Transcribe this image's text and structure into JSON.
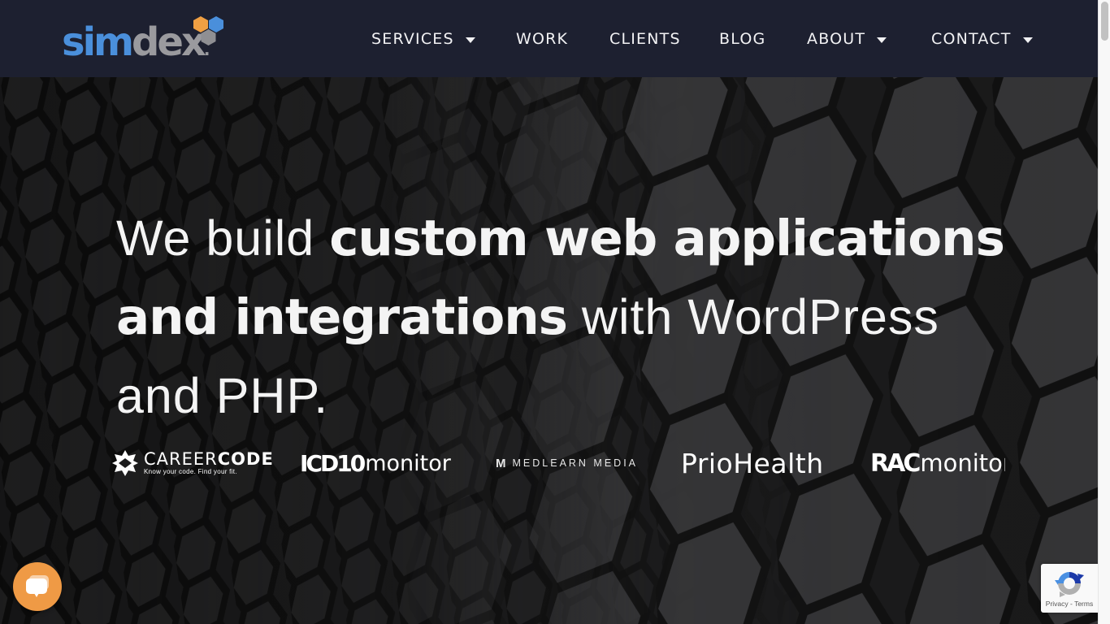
{
  "brand": {
    "name_part1": "sim",
    "name_part2": "dex",
    "name_dot": ".",
    "colors": {
      "blue": "#4a8fdb",
      "gray": "#9a9a9e",
      "orange": "#f0a043"
    }
  },
  "nav": {
    "items": [
      {
        "label": "SERVICES",
        "has_dropdown": true
      },
      {
        "label": "WORK",
        "has_dropdown": false
      },
      {
        "label": "CLIENTS",
        "has_dropdown": false
      },
      {
        "label": "BLOG",
        "has_dropdown": false
      },
      {
        "label": "ABOUT",
        "has_dropdown": true
      },
      {
        "label": "CONTACT",
        "has_dropdown": true
      }
    ]
  },
  "hero": {
    "headline": {
      "part1_light": "We build ",
      "part2_bold": "custom web applications and integrations",
      "part3_light": " with WordPress and PHP."
    }
  },
  "clients": {
    "careercode": {
      "name_light": "CAREER",
      "name_bold": "CODE",
      "tagline": "Know your code. Find your fit.",
      "icon": "careercode-star-icon"
    },
    "icd10": {
      "bold": "ICD10",
      "light": "monitor"
    },
    "medlearn": {
      "mark": "M",
      "name": "MEDLEARN MEDIA"
    },
    "priohealth": {
      "name": "PrioHealth"
    },
    "racmonitor": {
      "bold": "RAC",
      "light": "monitor"
    }
  },
  "chat": {
    "icon": "chat-bubble-icon",
    "color": "#ef9a45"
  },
  "recaptcha": {
    "privacy": "Privacy",
    "separator": " - ",
    "terms": "Terms",
    "icon": "recaptcha-icon"
  }
}
